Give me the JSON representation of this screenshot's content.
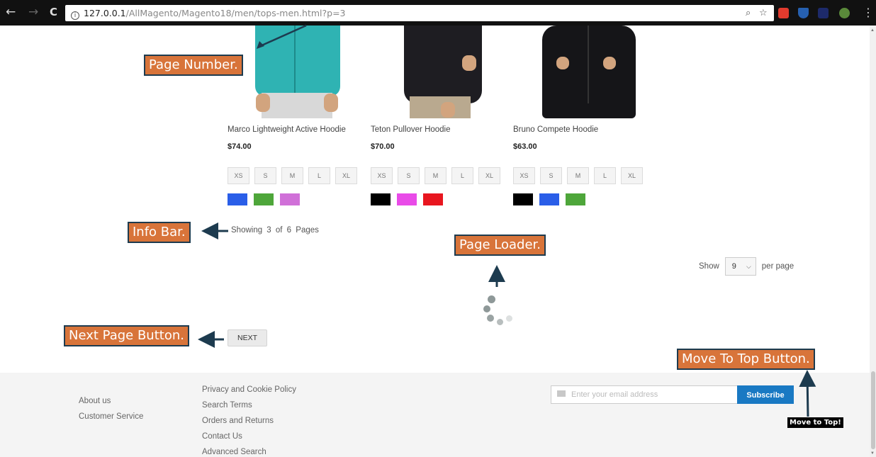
{
  "browser": {
    "back": "←",
    "forward": "→",
    "reload": "C",
    "url_host": "127.0.0.1",
    "url_path": "/AllMagento/Magento18/men/tops-men.html?p=3",
    "zoom_icon": "search-icon",
    "bookmark_icon": "star-icon",
    "menu": "⋮"
  },
  "products": [
    {
      "name": "Marco Lightweight Active Hoodie",
      "price": "$74.00",
      "sizes": [
        "XS",
        "S",
        "M",
        "L",
        "XL"
      ],
      "colors": [
        "#2a5ee8",
        "#4ea63a",
        "#d070d8"
      ]
    },
    {
      "name": "Teton Pullover Hoodie",
      "price": "$70.00",
      "sizes": [
        "XS",
        "S",
        "M",
        "L",
        "XL"
      ],
      "colors": [
        "#000000",
        "#e94be8",
        "#e8161f"
      ]
    },
    {
      "name": "Bruno Compete Hoodie",
      "price": "$63.00",
      "sizes": [
        "XS",
        "S",
        "M",
        "L",
        "XL"
      ],
      "colors": [
        "#000000",
        "#2a5ee8",
        "#4ea63a"
      ]
    }
  ],
  "toolbar": {
    "info": "Showing 3 of 6 Pages",
    "show_label": "Show",
    "limit_value": "9",
    "per_page_label": "per page",
    "next_label": "NEXT"
  },
  "annotations": {
    "page_number": "Page Number.",
    "info_bar": "Info Bar.",
    "page_loader": "Page Loader.",
    "next_page_button": "Next Page Button.",
    "move_to_top_button": "Move To Top Button."
  },
  "footer": {
    "links_col1": [
      "About us",
      "Customer Service"
    ],
    "links_col2": [
      "Privacy and Cookie Policy",
      "Search Terms",
      "Orders and Returns",
      "Contact Us",
      "Advanced Search"
    ],
    "newsletter_placeholder": "Enter your email address",
    "subscribe_label": "Subscribe",
    "move_to_top_tooltip": "Move to Top!"
  },
  "colors": {
    "callout_bg": "#d8743a",
    "callout_border": "#1d3b4f",
    "subscribe_bg": "#1979c3"
  }
}
